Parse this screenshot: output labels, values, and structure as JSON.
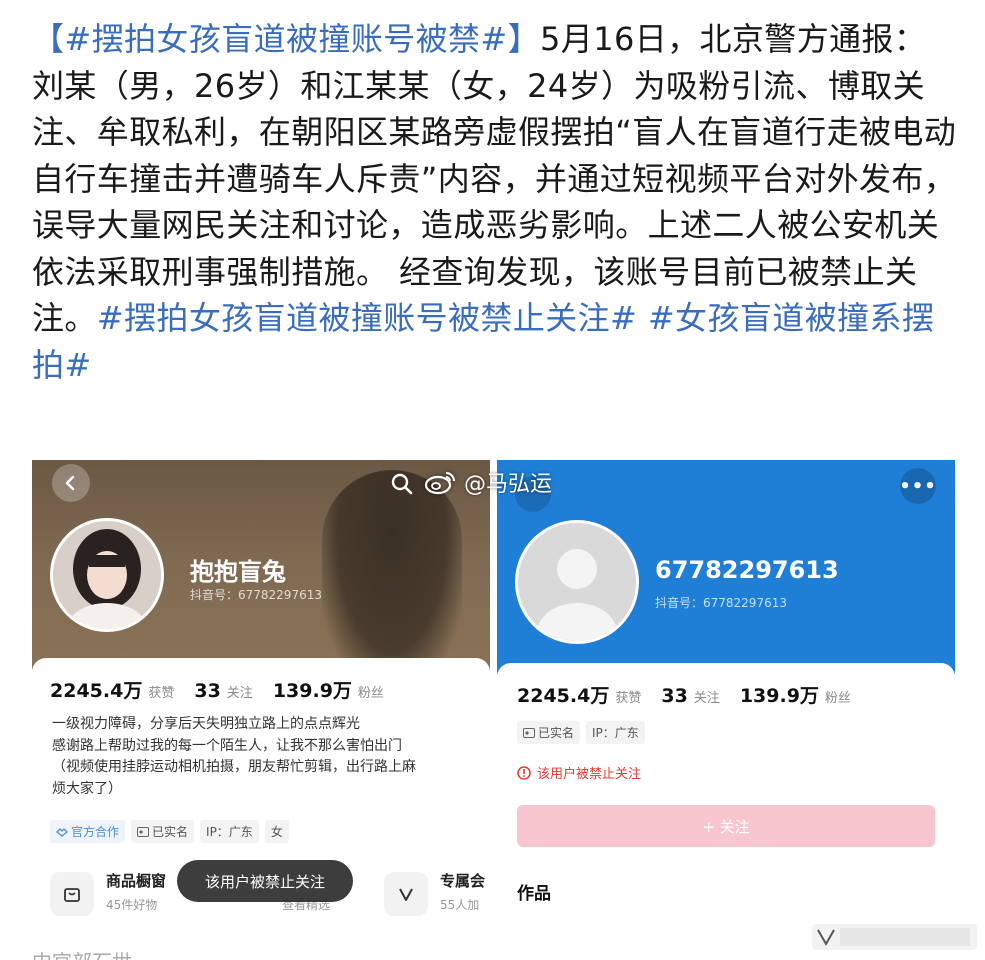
{
  "post": {
    "tag_main": "【#摆拍女孩盲道被撞账号被禁#】",
    "body_text": "5月16日，北京警方通报：刘某（男，26岁）和江某某（女，24岁）为吸粉引流、博取关注、牟取私利，在朝阳区某路旁虚假摆拍“盲人在盲道行走被电动自行车撞击并遭骑车人斥责”内容，并通过短视频平台对外发布，误导大量网民关注和讨论，造成恶劣影响。上述二人被公安机关依法采取刑事强制措施。 经查询发现，该账号目前已被禁止关注。",
    "tag_2": "#摆拍女孩盲道被撞账号被禁止关注#",
    "tag_3": "#女孩盲道被撞系摆拍#"
  },
  "watermark": {
    "text": "@马弘运"
  },
  "left_profile": {
    "nickname": "抱抱盲兔",
    "douyin_id": "抖音号：67782297613",
    "stats": [
      {
        "num": "2245.4万",
        "label": "获赞"
      },
      {
        "num": "33",
        "label": "关注"
      },
      {
        "num": "139.9万",
        "label": "粉丝"
      }
    ],
    "bio_lines": [
      "一级视力障碍，分享后天失明独立路上的点点辉光",
      "感谢路上帮助过我的每一个陌生人，让我不那么害怕出门",
      "（视频使用挂脖运动相机拍摄，朋友帮忙剪辑，出行路上麻",
      "烦大家了）"
    ],
    "chips": [
      "官方合作",
      "已实名",
      "IP：广东",
      "女"
    ],
    "shop": {
      "title": "商品橱窗",
      "sub": "45件好物"
    },
    "exclusive": {
      "title": "专属会",
      "sub": "55人加"
    },
    "hidden_sub": "查看精选",
    "toast": "该用户被禁止关注",
    "bottom_cut": "中官部石世"
  },
  "right_profile": {
    "nickname": "67782297613",
    "douyin_id": "抖音号：67782297613",
    "more_label": "•••",
    "stats": [
      {
        "num": "2245.4万",
        "label": "获赞"
      },
      {
        "num": "33",
        "label": "关注"
      },
      {
        "num": "139.9万",
        "label": "粉丝"
      }
    ],
    "chips": [
      "已实名",
      "IP：广东"
    ],
    "ban_notice": "该用户被禁止关注",
    "follow_label": "+ 关注",
    "works_label": "作品"
  },
  "colors": {
    "tag_blue": "#3b6dbd",
    "left_banner": "#7f6a52",
    "right_banner": "#1f7fd6",
    "ban_red": "#e53935",
    "follow_disabled": "#f8c6cf"
  }
}
